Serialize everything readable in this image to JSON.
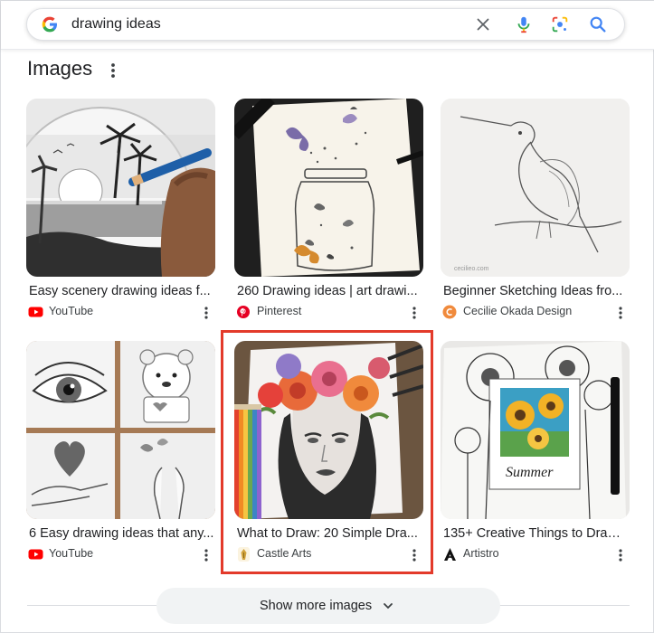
{
  "search": {
    "query": "drawing ideas",
    "icons": [
      "google-g-logo",
      "clear-icon",
      "microphone-icon",
      "google-lens-icon",
      "search-icon"
    ],
    "accent_color": "#4285f4"
  },
  "section": {
    "title": "Images",
    "more_icon": "vertical-dots-icon"
  },
  "results": [
    {
      "caption": "Easy scenery drawing ideas f...",
      "source": "YouTube",
      "source_icon": "youtube-icon",
      "thumbnail": "pencil sunset scenery drawing"
    },
    {
      "caption": "260 Drawing ideas | art drawi...",
      "source": "Pinterest",
      "source_icon": "pinterest-icon",
      "thumbnail": "butterflies in a jar drawing"
    },
    {
      "caption": "Beginner Sketching Ideas fro...",
      "source": "Cecilie Okada Design",
      "source_icon": "cecilie-okada-icon",
      "thumbnail": "hummingbird sketch"
    },
    {
      "caption": "6 Easy drawing ideas that any...",
      "source": "YouTube",
      "source_icon": "youtube-icon",
      "thumbnail": "eye, bear, heart and hands drawings"
    },
    {
      "caption": "What to Draw: 20 Simple Dra...",
      "source": "Castle Arts",
      "source_icon": "castle-arts-icon",
      "thumbnail": "portrait with flower crown and colored pencils",
      "highlighted": true
    },
    {
      "caption": "135+ Creative Things to Draw ...",
      "source": "Artistro",
      "source_icon": "artistro-icon",
      "thumbnail": "sunflowers summer drawing"
    }
  ],
  "show_more": {
    "label": "Show more images",
    "icon": "chevron-down-icon"
  },
  "colors": {
    "highlight_border": "#e33a2a",
    "youtube_red": "#ff0000",
    "pinterest_red": "#e60023"
  }
}
